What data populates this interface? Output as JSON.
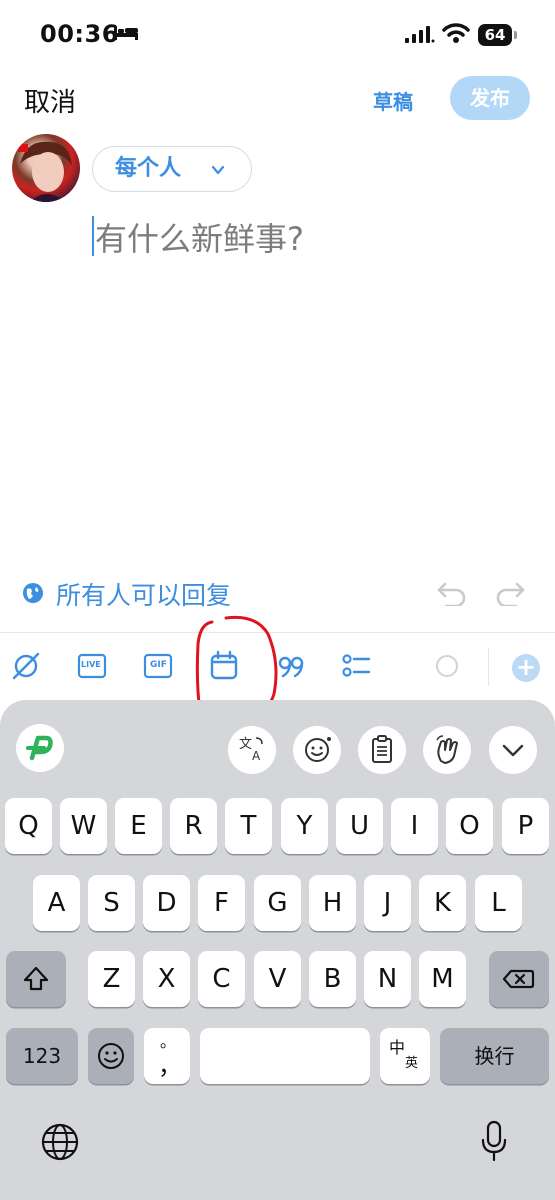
{
  "status_bar": {
    "time": "00:36",
    "battery": "64"
  },
  "header": {
    "cancel": "取消",
    "draft": "草稿",
    "post": "发布"
  },
  "compose": {
    "audience": "每个人",
    "placeholder": "有什么新鲜事?"
  },
  "reply_setting": "所有人可以回复",
  "toolbar": {
    "live": "LIVE",
    "gif": "GIF"
  },
  "keyboard": {
    "row1": [
      "Q",
      "W",
      "E",
      "R",
      "T",
      "Y",
      "U",
      "I",
      "O",
      "P"
    ],
    "row2": [
      "A",
      "S",
      "D",
      "F",
      "G",
      "H",
      "J",
      "K",
      "L"
    ],
    "row3": [
      "Z",
      "X",
      "C",
      "V",
      "B",
      "N",
      "M"
    ],
    "numbers": "123",
    "punct_top": "。",
    "punct_bottom": "，",
    "lang_zh": "中",
    "lang_en": "英",
    "return": "换行"
  },
  "colors": {
    "accent": "#3d8ee0",
    "post_disabled": "#b3d7f7",
    "annotation": "#e0141e"
  }
}
